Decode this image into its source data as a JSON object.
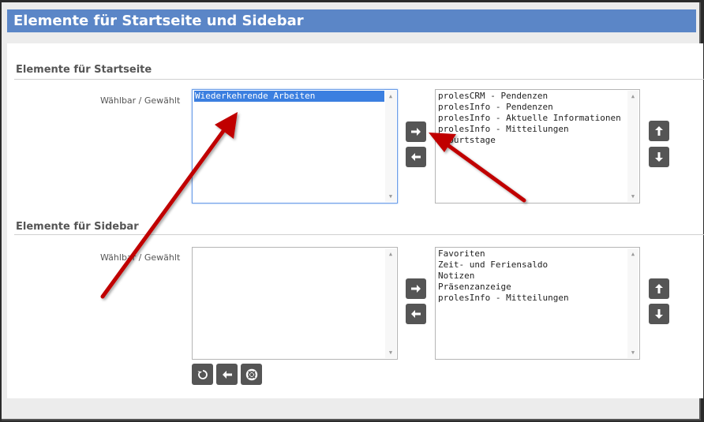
{
  "header": {
    "title": "Elemente für Startseite und Sidebar"
  },
  "startseite": {
    "title": "Elemente für Startseite",
    "label": "Wählbar / Gewählt",
    "available": [
      "Wiederkehrende Arbeiten"
    ],
    "selected": [
      "prolesCRM - Pendenzen",
      "prolesInfo - Pendenzen",
      "prolesInfo - Aktuelle Informationen",
      "prolesInfo - Mitteilungen",
      "Geburtstage"
    ]
  },
  "sidebar": {
    "title": "Elemente für Sidebar",
    "label": "Wählbar / Gewählt",
    "available": [],
    "selected": [
      "Favoriten",
      "Zeit- und Feriensaldo",
      "Notizen",
      "Präsenzanzeige",
      "prolesInfo - Mitteilungen"
    ]
  },
  "icons": {
    "move_right": "arrow-right-icon",
    "move_left": "arrow-left-icon",
    "move_up": "arrow-up-icon",
    "move_down": "arrow-down-icon",
    "refresh": "refresh-icon",
    "back": "arrow-left-icon",
    "help": "lifebuoy-icon"
  },
  "colors": {
    "header_bg": "#5b86c7",
    "button_bg": "#555555",
    "selection": "#3b7fe0",
    "annotation_arrow": "#c00000"
  }
}
